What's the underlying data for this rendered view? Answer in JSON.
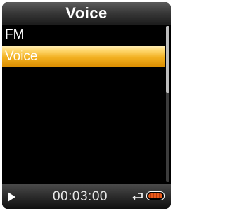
{
  "header": {
    "title": "Voice"
  },
  "menu": {
    "items": [
      {
        "label": "FM",
        "selected": false
      },
      {
        "label": "Voice",
        "selected": true
      }
    ]
  },
  "status": {
    "play_state_icon": "play-icon",
    "time": "00:03:00",
    "repeat_icon": "repeat-icon",
    "battery_icon": "battery-icon"
  },
  "colors": {
    "selection_accent": "#f2b020",
    "background": "#000000",
    "battery_fill": "#e85a1a"
  }
}
